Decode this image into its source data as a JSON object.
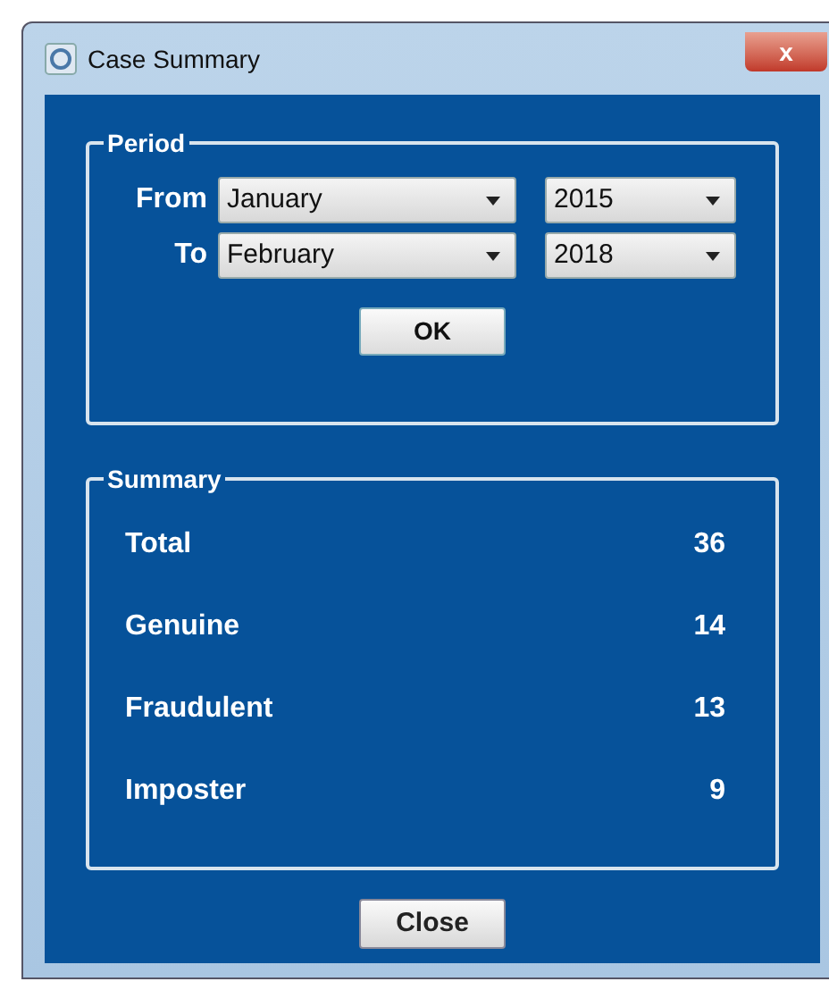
{
  "window": {
    "title": "Case Summary",
    "close": "x"
  },
  "period": {
    "title": "Period",
    "rows": [
      {
        "label": "From",
        "month": "January",
        "year": "2015"
      },
      {
        "label": "To",
        "month": "February",
        "year": "2018"
      }
    ],
    "ok_button": "OK"
  },
  "summary": {
    "title": "Summary",
    "rows": [
      {
        "label": "Total",
        "value": "36"
      },
      {
        "label": "Genuine",
        "value": "14"
      },
      {
        "label": "Fraudulent",
        "value": "13"
      },
      {
        "label": "Imposter",
        "value": "9"
      }
    ]
  },
  "close_button": "Close"
}
